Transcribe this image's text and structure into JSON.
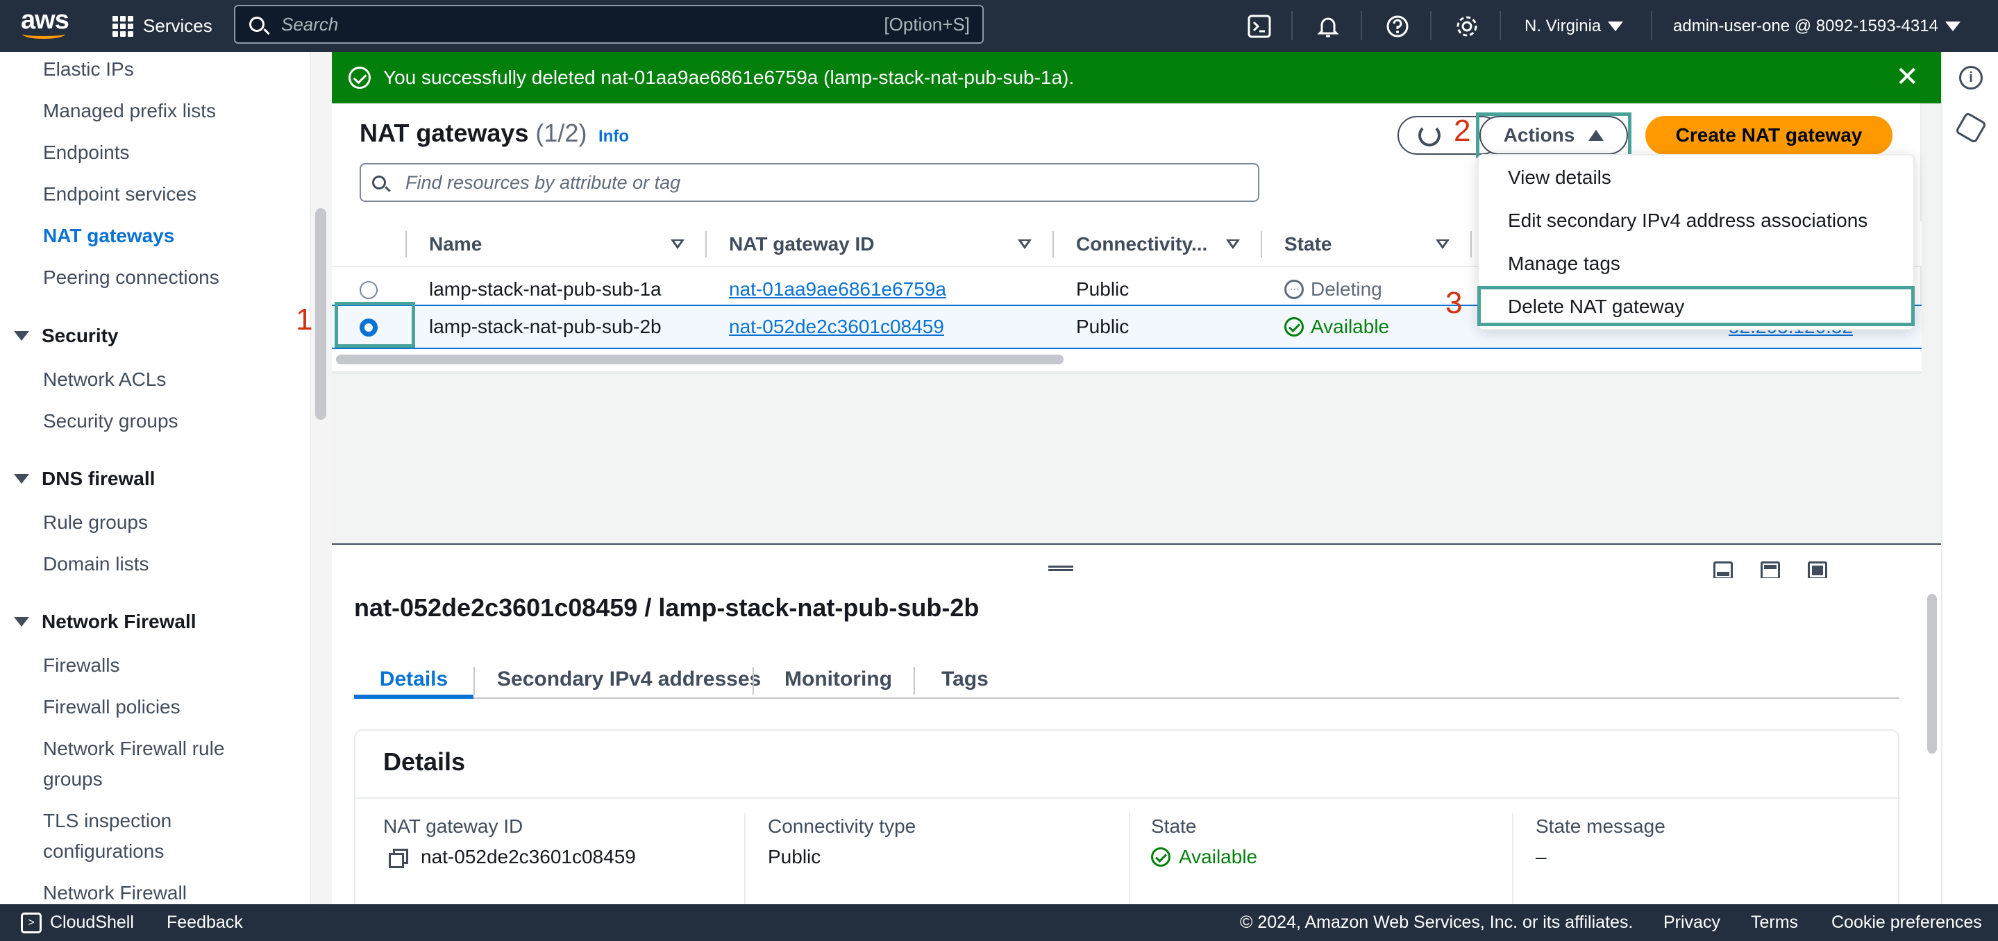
{
  "topnav": {
    "logo": "aws",
    "services_label": "Services",
    "search_placeholder": "Search",
    "search_shortcut": "[Option+S]",
    "region": "N. Virginia",
    "account": "admin-user-one @ 8092-1593-4314",
    "icons": [
      "cloudshell-icon",
      "bell-icon",
      "help-icon",
      "settings-icon"
    ]
  },
  "sidebar": {
    "items_top": [
      "Elastic IPs",
      "Managed prefix lists",
      "Endpoints",
      "Endpoint services",
      "NAT gateways",
      "Peering connections"
    ],
    "active": "NAT gateways",
    "security": {
      "heading": "Security",
      "items": [
        "Network ACLs",
        "Security groups"
      ]
    },
    "dns_firewall": {
      "heading": "DNS firewall",
      "items": [
        "Rule groups",
        "Domain lists"
      ]
    },
    "network_firewall": {
      "heading": "Network Firewall",
      "items": [
        "Firewalls",
        "Firewall policies",
        "Network Firewall rule",
        "groups",
        "TLS inspection",
        "configurations",
        "Network Firewall"
      ]
    }
  },
  "flash": {
    "message": "You successfully deleted nat-01aa9ae6861e6759a (lamp-stack-nat-pub-sub-1a)."
  },
  "list": {
    "title": "NAT gateways",
    "count": "(1/2)",
    "info": "Info",
    "actions_label": "Actions",
    "create_label": "Create NAT gateway",
    "filter_placeholder": "Find resources by attribute or tag",
    "columns": [
      "Name",
      "NAT gateway ID",
      "Connectivity...",
      "State"
    ],
    "rows": [
      {
        "name": "lamp-stack-nat-pub-sub-1a",
        "id": "nat-01aa9ae6861e6759a",
        "connectivity": "Public",
        "state": "Deleting",
        "selected": false
      },
      {
        "name": "lamp-stack-nat-pub-sub-2b",
        "id": "nat-052de2c3601c08459",
        "connectivity": "Public",
        "state": "Available",
        "selected": true
      }
    ],
    "partial_value": "52.203.120.32"
  },
  "actions_menu": {
    "items": [
      "View details",
      "Edit secondary IPv4 address associations",
      "Manage tags",
      "Delete NAT gateway"
    ]
  },
  "annotations": {
    "step1": "1",
    "step2": "2",
    "step3": "3",
    "color": "#d13212",
    "highlight": "#4aa39a"
  },
  "detail": {
    "title": "nat-052de2c3601c08459 / lamp-stack-nat-pub-sub-2b",
    "tabs": [
      "Details",
      "Secondary IPv4 addresses",
      "Monitoring",
      "Tags"
    ],
    "active_tab": "Details",
    "section": "Details",
    "fields": [
      {
        "label": "NAT gateway ID",
        "value": "nat-052de2c3601c08459"
      },
      {
        "label": "Connectivity type",
        "value": "Public"
      },
      {
        "label": "State",
        "value": "Available"
      },
      {
        "label": "State message",
        "value": "–"
      }
    ]
  },
  "footer": {
    "cloudshell": "CloudShell",
    "feedback": "Feedback",
    "copyright": "© 2024, Amazon Web Services, Inc. or its affiliates.",
    "privacy": "Privacy",
    "terms": "Terms",
    "cookies": "Cookie preferences"
  },
  "colors": {
    "nav_bg": "#232f3e",
    "success": "#037f0c",
    "link": "#0972d3",
    "primary_btn": "#ff9900"
  }
}
